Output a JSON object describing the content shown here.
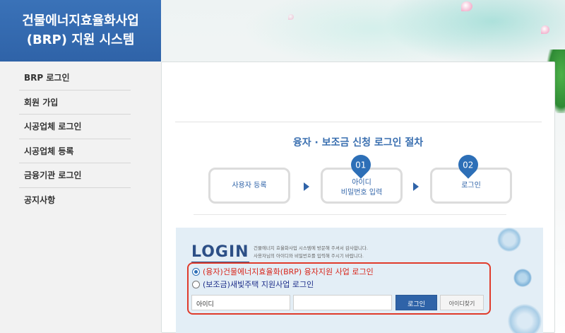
{
  "sidebar": {
    "title_line1": "건물에너지효율화사업",
    "title_line2": "(BRP) 지원 시스템",
    "items": [
      {
        "label": "BRP 로그인"
      },
      {
        "label": "회원 가입"
      },
      {
        "label": "시공업체 로그인"
      },
      {
        "label": "시공업체 등록"
      },
      {
        "label": "금융기관 로그인"
      },
      {
        "label": "공지사항"
      }
    ]
  },
  "procedure": {
    "title": "융자 · 보조금 신청 로그인 절차",
    "steps": [
      {
        "label": "사용자 등록"
      },
      {
        "badge": "01",
        "label_line1": "아이디",
        "label_line2": "비밀번호 입력"
      },
      {
        "badge": "02",
        "label": "로그인"
      }
    ]
  },
  "login": {
    "logo": "LOGIN",
    "desc_line1": "건물에너지 효율화사업 시스템에 방문해 주셔서 감사합니다.",
    "desc_line2": "사용자님의 아이디와 비밀번호를 입력해 주시기 바랍니다.",
    "option1": "(융자)건물에너지효율화(BRP) 융자지원 사업 로그인",
    "option2": "(보조금)새빛주택 지원사업 로그인",
    "id_value": "아이디",
    "password_value": "",
    "login_button": "로그인",
    "find_id_button": "아이디찾기"
  },
  "colors": {
    "header_blue": "#2f63a8",
    "highlight_red": "#e03b2b",
    "accent_blue": "#2d6fb7"
  }
}
